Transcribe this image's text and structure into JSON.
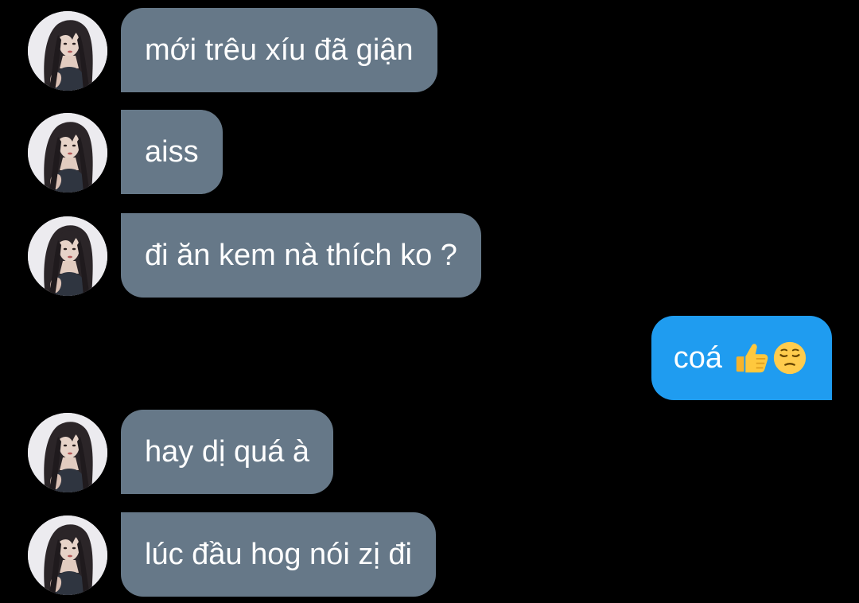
{
  "conversation": {
    "messages": [
      {
        "side": "incoming",
        "text": "mới trêu xíu đã giận"
      },
      {
        "side": "incoming",
        "text": "aiss"
      },
      {
        "side": "incoming",
        "text": "đi ăn kem nà thích ko ?"
      },
      {
        "side": "outgoing",
        "text": "coá",
        "emojis": [
          "thumbs-up-emoji",
          "pensive-face-emoji"
        ]
      },
      {
        "side": "incoming",
        "text": "hay dị quá à"
      },
      {
        "side": "incoming",
        "text": "lúc đầu hog nói zị đi"
      }
    ]
  },
  "colors": {
    "background": "#000000",
    "incoming_bubble": "#667888",
    "outgoing_bubble": "#1f9cf0",
    "text": "#ffffff"
  },
  "icons": {
    "avatar": "contact-avatar-photo"
  }
}
